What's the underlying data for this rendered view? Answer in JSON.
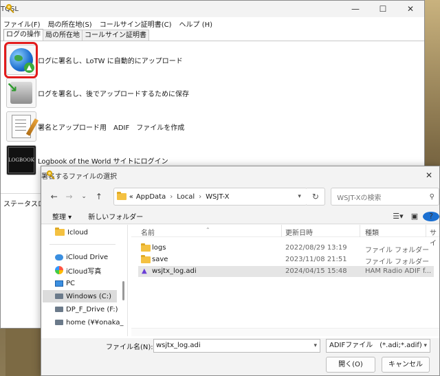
{
  "tqsl": {
    "title": "TQSL",
    "window_controls": {
      "minimize": "—",
      "maximize": "☐",
      "close": "✕"
    },
    "menu": [
      "ファイル(F)",
      "局の所在地(S)",
      "コールサイン証明書(C)",
      "ヘルプ (H)"
    ],
    "tabs": [
      "ログの操作",
      "局の所在地",
      "コールサイン証明書"
    ],
    "actions": [
      {
        "label": "ログに署名し、LoTW に自動的にアップロード",
        "icon": "globe-upload-icon"
      },
      {
        "label": "ログを署名し、後でアップロードするために保存",
        "icon": "save-disk-icon"
      },
      {
        "label": "署名とアップロード用　ADIF　ファイルを作成",
        "icon": "edit-document-icon"
      },
      {
        "label": "Logbook of the World サイトにログイン",
        "icon": "lotw-logo-icon"
      }
    ],
    "status_label": "ステータスログ",
    "lotw_logo_text": "LOGBOOK"
  },
  "dialog": {
    "title": "署名するファイルの選択",
    "close": "✕",
    "breadcrumb": [
      "AppData",
      "Local",
      "WSJT-X"
    ],
    "breadcrumb_prefix": "«",
    "search_placeholder": "WSJT-Xの検索",
    "toolbar": {
      "organize": "整理 ▾",
      "new_folder": "新しいフォルダー"
    },
    "nav": [
      "Icloud",
      "iCloud Drive",
      "iCloud写真",
      "PC",
      "Windows (C:)",
      "DP_F_Drive (F:)",
      "home (¥¥onaka_"
    ],
    "columns": {
      "name": "名前",
      "date": "更新日時",
      "type": "種類",
      "size": "サイ"
    },
    "files": [
      {
        "name": "logs",
        "date": "2022/08/29 13:19",
        "type": "ファイル フォルダー",
        "kind": "folder"
      },
      {
        "name": "save",
        "date": "2023/11/08 21:51",
        "type": "ファイル フォルダー",
        "kind": "folder"
      },
      {
        "name": "wsjtx_log.adi",
        "date": "2024/04/15 15:48",
        "type": "HAM Radio ADIF f...",
        "kind": "adi"
      }
    ],
    "filename_label": "ファイル名(N):",
    "filename_value": "wsjtx_log.adi",
    "filter_value": "ADIFファイル　(*.adi;*.adif)",
    "open_button": "開く(O)",
    "cancel_button": "キャンセル"
  },
  "colors": {
    "highlight": "#e21b1b",
    "accent": "#1a6fd1"
  }
}
